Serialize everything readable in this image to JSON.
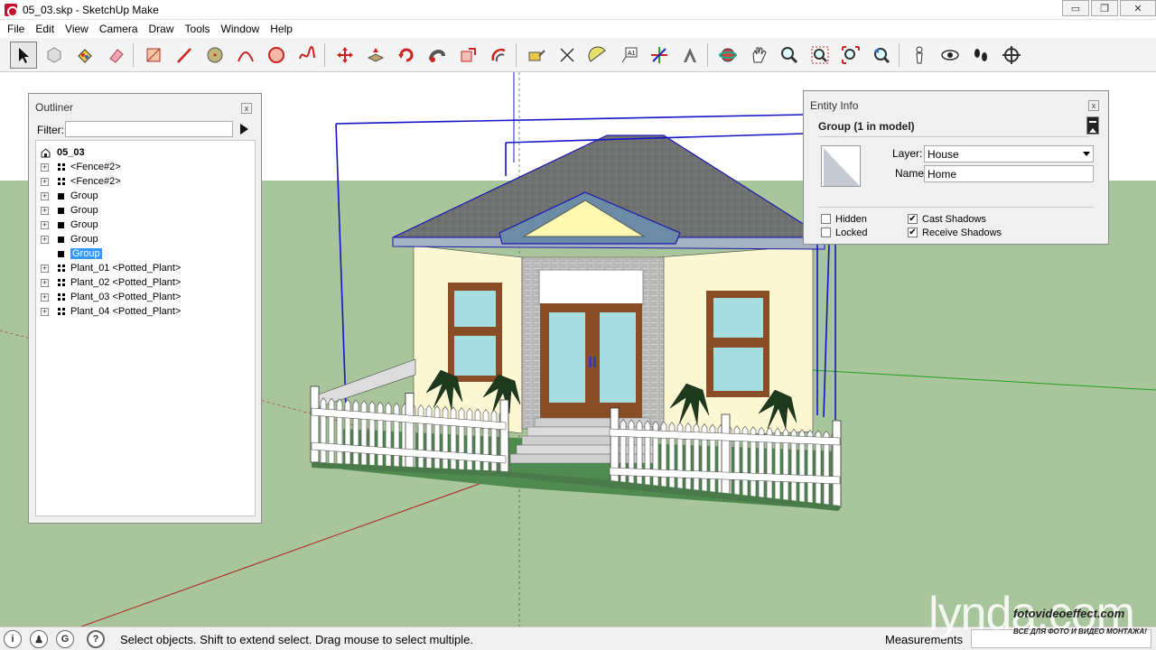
{
  "window": {
    "title": "05_03.skp - SketchUp Make",
    "minimize": "▭",
    "restore": "❐",
    "close": "✕"
  },
  "menu": [
    "File",
    "Edit",
    "View",
    "Camera",
    "Draw",
    "Tools",
    "Window",
    "Help"
  ],
  "toolbar": {
    "tools": [
      "select-icon",
      "component-icon",
      "paint-bucket-icon",
      "eraser-icon",
      "rectangle-icon",
      "line-icon",
      "circle-icon",
      "arc-icon",
      "polygon-icon",
      "freehand-icon",
      "move-icon",
      "push-pull-icon",
      "rotate-icon",
      "follow-me-icon",
      "scale-icon",
      "offset-icon",
      "tape-measure-icon",
      "dimension-icon",
      "protractor-icon",
      "text-icon",
      "axes-icon",
      "3d-text-icon",
      "orbit-icon",
      "pan-icon",
      "zoom-icon",
      "zoom-window-icon",
      "zoom-extents-icon",
      "previous-view-icon",
      "position-camera-icon",
      "look-around-icon",
      "walk-icon",
      "section-plane-icon"
    ]
  },
  "outliner": {
    "title": "Outliner",
    "close": "x",
    "filter_label": "Filter:",
    "filter_value": "",
    "root": "05_03",
    "items": [
      {
        "label": "<Fence#2>",
        "type": "component",
        "expandable": true,
        "selected": false
      },
      {
        "label": "<Fence#2>",
        "type": "component",
        "expandable": true,
        "selected": false
      },
      {
        "label": "Group",
        "type": "group",
        "expandable": true,
        "selected": false
      },
      {
        "label": "Group",
        "type": "group",
        "expandable": true,
        "selected": false
      },
      {
        "label": "Group",
        "type": "group",
        "expandable": true,
        "selected": false
      },
      {
        "label": "Group",
        "type": "group",
        "expandable": true,
        "selected": false
      },
      {
        "label": "Group",
        "type": "group",
        "expandable": false,
        "selected": true
      },
      {
        "label": "Plant_01 <Potted_Plant>",
        "type": "component",
        "expandable": true,
        "selected": false
      },
      {
        "label": "Plant_02 <Potted_Plant>",
        "type": "component",
        "expandable": true,
        "selected": false
      },
      {
        "label": "Plant_03 <Potted_Plant>",
        "type": "component",
        "expandable": true,
        "selected": false
      },
      {
        "label": "Plant_04 <Potted_Plant>",
        "type": "component",
        "expandable": true,
        "selected": false
      }
    ]
  },
  "entity_info": {
    "title": "Entity Info",
    "close": "x",
    "heading": "Group (1 in model)",
    "layer_label": "Layer:",
    "layer_value": "House",
    "name_label": "Name:",
    "name_value": "Home",
    "hidden_label": "Hidden",
    "hidden_checked": false,
    "locked_label": "Locked",
    "locked_checked": false,
    "cast_label": "Cast Shadows",
    "cast_checked": true,
    "receive_label": "Receive Shadows",
    "receive_checked": true,
    "check_mark": "✔"
  },
  "status": {
    "icons": [
      "geo-location-icon",
      "credits-icon",
      "sign-in-icon",
      "help-icon"
    ],
    "text": "Select objects. Shift to extend select. Drag mouse to select multiple.",
    "measurements_label": "Measurements",
    "measurements_value": ""
  },
  "watermark": {
    "brand": "lynda.com",
    "site": "fotovideoeffect.com",
    "tagline": "ВСЕ ДЛЯ ФОТО И ВИДЕО МОНТАЖА!"
  },
  "colors": {
    "sky": "#ffffff",
    "ground": "#a8c49a",
    "selection": "#1010c8",
    "wall": "#fdf8d3",
    "roof": "#6e6f6e",
    "door": "#9ad4d9"
  }
}
